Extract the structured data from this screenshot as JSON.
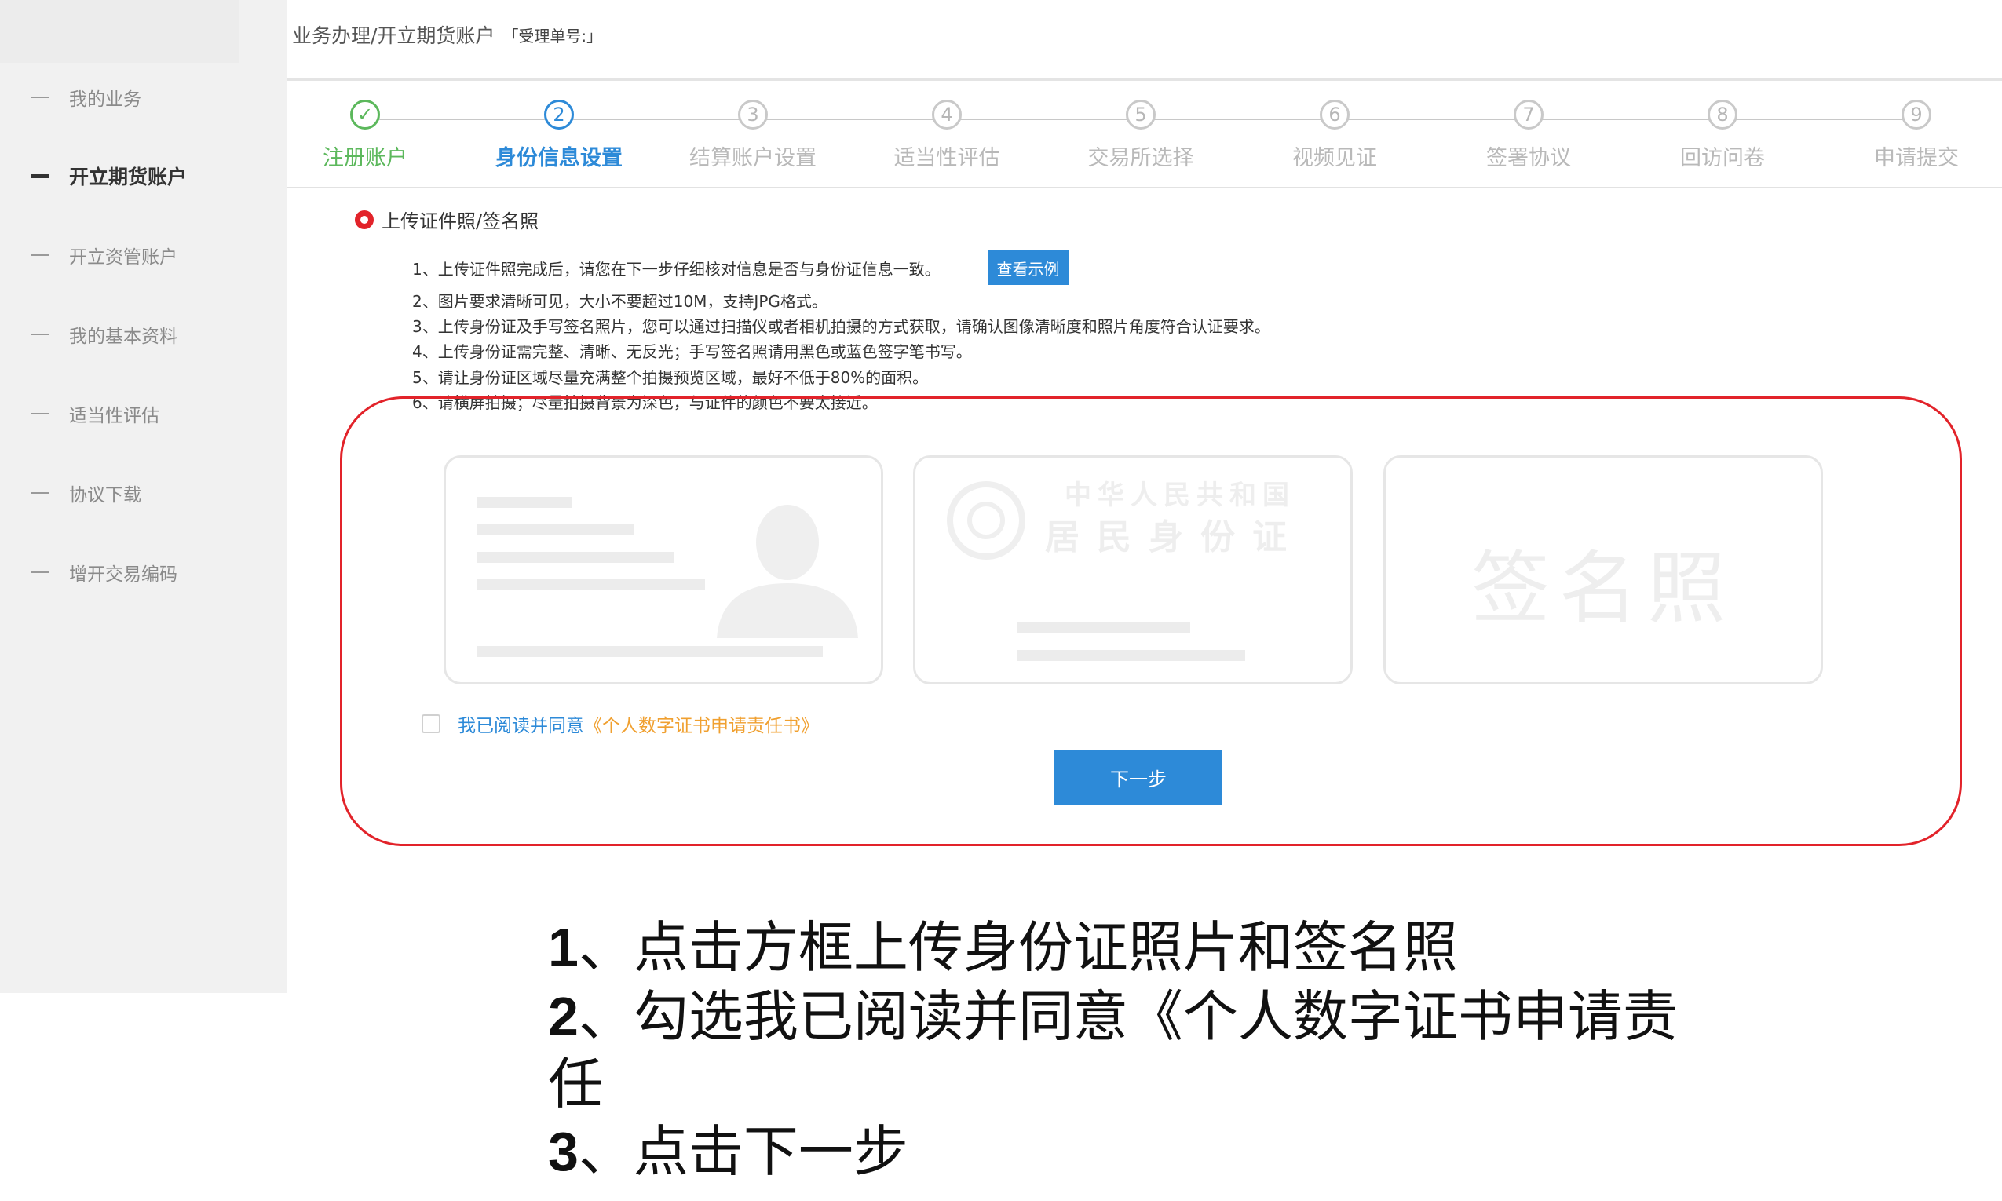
{
  "breadcrumb": {
    "path": "业务办理/开立期货账户",
    "order_label": "「受理单号:」"
  },
  "sidebar": {
    "items": [
      {
        "label": "我的业务",
        "active": false
      },
      {
        "label": "开立期货账户",
        "active": true
      },
      {
        "label": "开立资管账户",
        "active": false
      },
      {
        "label": "我的基本资料",
        "active": false
      },
      {
        "label": "适当性评估",
        "active": false
      },
      {
        "label": "协议下载",
        "active": false
      },
      {
        "label": "增开交易编码",
        "active": false
      }
    ]
  },
  "steps": [
    {
      "num": "✓",
      "label": "注册账户",
      "state": "done"
    },
    {
      "num": "2",
      "label": "身份信息设置",
      "state": "current"
    },
    {
      "num": "3",
      "label": "结算账户设置",
      "state": "todo"
    },
    {
      "num": "4",
      "label": "适当性评估",
      "state": "todo"
    },
    {
      "num": "5",
      "label": "交易所选择",
      "state": "todo"
    },
    {
      "num": "6",
      "label": "视频见证",
      "state": "todo"
    },
    {
      "num": "7",
      "label": "签署协议",
      "state": "todo"
    },
    {
      "num": "8",
      "label": "回访问卷",
      "state": "todo"
    },
    {
      "num": "9",
      "label": "申请提交",
      "state": "todo"
    }
  ],
  "section": {
    "title": "上传证件照/签名照",
    "instructions": [
      "1、上传证件照完成后，请您在下一步仔细核对信息是否与身份证信息一致。",
      "2、图片要求清晰可见，大小不要超过10M，支持JPG格式。",
      "3、上传身份证及手写签名照片，您可以通过扫描仪或者相机拍摄的方式获取，请确认图像清晰度和照片角度符合认证要求。",
      "4、上传身份证需完整、清晰、无反光；手写签名照请用黑色或蓝色签字笔书写。",
      "5、请让身份证区域尽量充满整个拍摄预览区域，最好不低于80%的面积。",
      "6、请横屏拍摄；尽量拍摄背景为深色，与证件的颜色不要太接近。"
    ],
    "example_button": "查看示例"
  },
  "cards": {
    "back_line1": "中华人民共和国",
    "back_line2": "居民身份证",
    "sign_label": "签名照"
  },
  "agreement": {
    "text": "我已阅读并同意",
    "link": "《个人数字证书申请责任书》",
    "checked": false
  },
  "next_button": "下一步",
  "guide": {
    "line1": "、点击方框上传身份证照片和签名照",
    "line2a": "、勾选我已阅读并同意《个人数字证书申请责",
    "line2b": "任",
    "line3": "、点击下一步",
    "num1": "1",
    "num2": "2",
    "num3": "3"
  },
  "colors": {
    "accent": "#2d8ad8",
    "done": "#5cb85c",
    "highlight": "#e2232a",
    "link": "#f0a030"
  }
}
